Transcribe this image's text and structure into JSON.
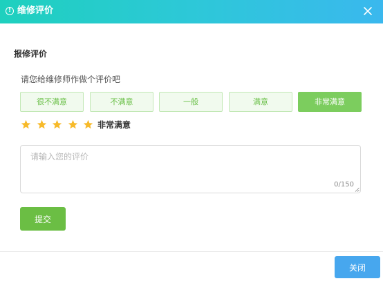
{
  "header": {
    "title": "维修评价",
    "info_icon_glyph": "!",
    "info_icon": "info-circle-icon",
    "close_icon": "close-icon",
    "gradient_colors": [
      "#1ed0be",
      "#3ab8ee"
    ]
  },
  "form": {
    "section_title": "报修评价",
    "prompt": "请您给维修师作做个评价吧",
    "options": [
      {
        "label": "很不满意",
        "selected": false
      },
      {
        "label": "不满意",
        "selected": false
      },
      {
        "label": "一般",
        "selected": false
      },
      {
        "label": "满意",
        "selected": false
      },
      {
        "label": "非常满意",
        "selected": true
      }
    ],
    "rating": {
      "value": 5,
      "max": 5,
      "label": "非常满意",
      "star_color": "#f7ba2a",
      "icon": "star-icon"
    },
    "comment": {
      "value": "",
      "placeholder": "请输入您的评价",
      "counter": "0/150"
    },
    "submit_label": "提交"
  },
  "footer": {
    "close_label": "关闭"
  },
  "colors": {
    "option_selected": "#7ccd5e",
    "option_text": "#6cc04a",
    "submit": "#6bbe44",
    "close_button": "#47a7ee"
  }
}
